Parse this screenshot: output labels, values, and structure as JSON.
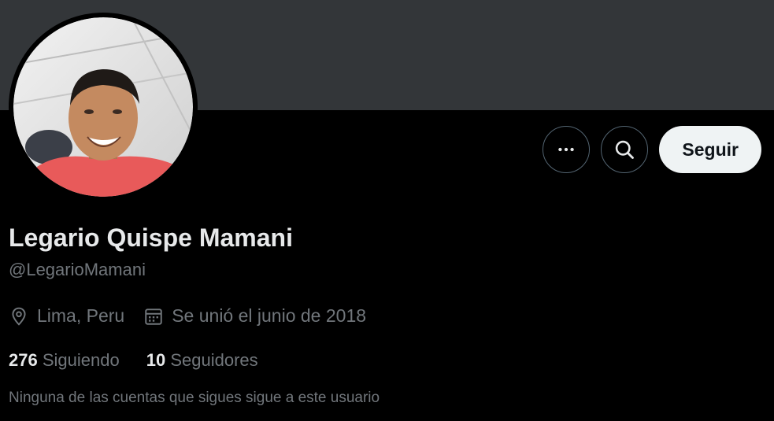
{
  "profile": {
    "display_name": "Legario Quispe Mamani",
    "handle": "@LegarioMamani",
    "location": "Lima, Peru",
    "joined": "Se unió el junio de 2018",
    "following_count": "276",
    "following_label": "Siguiendo",
    "followers_count": "10",
    "followers_label": "Seguidores",
    "mutual_note": "Ninguna de las cuentas que sigues sigue a este usuario"
  },
  "actions": {
    "more_icon": "more-icon",
    "search_icon": "search-icon",
    "follow_label": "Seguir"
  },
  "colors": {
    "banner": "#333639",
    "background": "#000000",
    "primary_text": "#e7e9ea",
    "secondary_text": "#71767b",
    "follow_button_bg": "#eff3f4"
  }
}
